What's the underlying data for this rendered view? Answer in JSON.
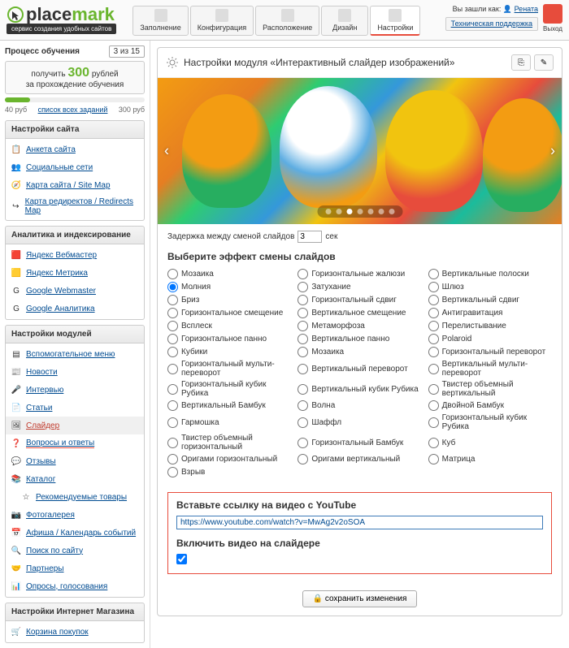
{
  "logo": {
    "text1": "place",
    "text2": "mark",
    "sub": "сервис создания удобных сайтов"
  },
  "tabs": [
    "Заполнение",
    "Конфигурация",
    "Расположение",
    "Дизайн",
    "Настройки"
  ],
  "user": {
    "logged": "Вы зашли как:",
    "name": "Рената",
    "support": "Техническая поддержка",
    "exit": "Выход"
  },
  "progress": {
    "title": "Процесс обучения",
    "badge": "3 из 15",
    "promo1": "получить",
    "promo_amount": "300",
    "promo_currency": "рублей",
    "promo2": "за прохождение обучения",
    "left": "40 руб",
    "link": "список всех заданий",
    "right": "300 руб"
  },
  "panels": {
    "site": {
      "title": "Настройки сайта",
      "items": [
        "Анкета сайта",
        "Социальные сети",
        "Карта сайта / Site Map",
        "Карта редиректов / Redirects Map"
      ]
    },
    "analytics": {
      "title": "Аналитика и индексирование",
      "items": [
        "Яндекс Вебмастер",
        "Яндекс Метрика",
        "Google Webmaster",
        "Google Аналитика"
      ]
    },
    "modules": {
      "title": "Настройки модулей",
      "items": [
        "Вспомогательное меню",
        "Новости",
        "Интервью",
        "Статьи",
        "Слайдер",
        "Вопросы и ответы",
        "Отзывы",
        "Каталог",
        "Рекомендуемые товары",
        "Фотогалерея",
        "Афиша / Календарь событий",
        "Поиск по сайту",
        "Партнеры",
        "Опросы, голосования"
      ]
    },
    "shop": {
      "title": "Настройки Интернет Магазина",
      "items": [
        "Корзина покупок"
      ]
    }
  },
  "module": {
    "title": "Настройки модуля «Интерактивный слайдер изображений»",
    "delay_label": "Задержка между сменой слайдов",
    "delay_value": "3",
    "delay_unit": "сек",
    "effects_title": "Выберите эффект смены слайдов",
    "effects": [
      "Мозаика",
      "Горизонтальные жалюзи",
      "Вертикальные полоски",
      "Молния",
      "Затухание",
      "Шлюз",
      "Бриз",
      "Горизонтальный сдвиг",
      "Вертикальный сдвиг",
      "Горизонтальное смещение",
      "Вертикальное смещение",
      "Антигравитация",
      "Всплеск",
      "Метаморфоза",
      "Перелистывание",
      "Горизонтальное панно",
      "Вертикальное панно",
      "Polaroid",
      "Кубики",
      "Мозаика",
      "Горизонтальный переворот",
      "Горизонтальный мульти-переворот",
      "Вертикальный переворот",
      "Вертикальный мульти-переворот",
      "Горизонтальный кубик Рубика",
      "Вертикальный кубик Рубика",
      "Твистер объемный вертикальный",
      "Вертикальный Бамбук",
      "Волна",
      "Двойной Бамбук",
      "Гармошка",
      "Шаффл",
      "Горизонтальный кубик Рубика",
      "Твистер объемный горизонтальный",
      "Горизонтальный Бамбук",
      "Куб",
      "Оригами горизонтальный",
      "Оригами вертикальный",
      "Матрица",
      "Взрыв"
    ],
    "selected_effect": "Молния",
    "youtube_title": "Вставьте ссылку на видео с YouTube",
    "youtube_value": "https://www.youtube.com/watch?v=MwAg2v2oSOA",
    "enable_video": "Включить видео на слайдере",
    "save": "сохранить изменения"
  }
}
